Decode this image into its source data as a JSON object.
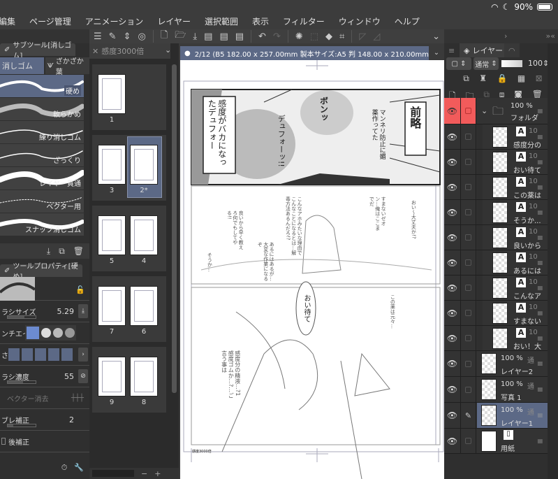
{
  "status": {
    "battery": "90%",
    "battery_level": 0.9
  },
  "menu": [
    "編集",
    "ページ管理",
    "アニメーション",
    "レイヤー",
    "選択範囲",
    "表示",
    "フィルター",
    "ウィンドウ",
    "ヘルプ"
  ],
  "toolbar": {
    "icons": [
      "menu-icon",
      "tool-icon",
      "updown-icon",
      "spiral-icon",
      "new-file-icon",
      "open-folder-icon",
      "save-icon",
      "jpg-export-icon",
      "png-export-icon",
      "psd-export-icon",
      "undo-icon",
      "redo-icon",
      "select-clear-icon",
      "select-invert-icon",
      "fill-icon",
      "transform-icon",
      "ruler-off-icon",
      "ruler-icon",
      "chevron-down-icon"
    ]
  },
  "subtool": {
    "title": "サブツール[消しゴム]",
    "groups": [
      "消しゴム",
      "ざかざか葉"
    ],
    "brushes": [
      "硬め",
      "軟らかめ",
      "練り消しゴム",
      "ざっくり",
      "レイヤー貫通",
      "ベクター用",
      "スナップ消しゴム"
    ],
    "selected": 0
  },
  "toolprop": {
    "title": "ツールプロパティ[硬め]",
    "brush_size_label": "ラシサイズ",
    "brush_size": "5.29",
    "aa_label": "ンチエイリ",
    "hardness_label": "さ",
    "density_label": "ラシ濃度",
    "density": "55",
    "vector_label": "ベクター消去",
    "stab_label": "ブレ補正",
    "stab": "2",
    "post_label": "後補正",
    "brush_size_fraction": 0.6,
    "density_fraction": 0.55,
    "stab_fraction": 0.2
  },
  "pages": {
    "tab": "感度3000倍",
    "items": [
      {
        "label": "1"
      },
      {
        "label": "3"
      },
      {
        "label": "2*"
      },
      {
        "label": "5"
      },
      {
        "label": "4"
      },
      {
        "label": "7"
      },
      {
        "label": "6"
      },
      {
        "label": "9"
      },
      {
        "label": "8"
      }
    ],
    "selected": "2*"
  },
  "canvas": {
    "tab": "2/12 (B5 182.00 x 257.00mm 製本サイズ:A5 判 148.00 x 210.00mm 350dpi 3",
    "texts": {
      "zenryaku": "前略",
      "caption": "感度がバカになったデュフォー",
      "shout": "デュフォーッ!!",
      "boom": "ボンッ",
      "note": "マンネリ防止に媚薬作ってた",
      "p2a": "おい～大丈夫か!?",
      "p2b": "すまないゼオン…俺はここまでだ",
      "p2c": "こんなアホみたいな理由でこんなことになるとは…解毒方法あるんだろ!?",
      "p2d": "あるにはあるが…大変な作業になるぞ",
      "p2e": "良いから早く教えろ何でもしてやる!!",
      "p2f": "そうか…",
      "p3a": "この薬は元々…",
      "p3b": "おい待て",
      "p3c": "感度分の精液…?1感度ゴムか…?…ご言う事は",
      "footer": "感度3000倍"
    }
  },
  "layers": {
    "tab": "レイヤー",
    "blend": "通常",
    "opacity": "100",
    "folder": {
      "pct": "100 %",
      "name": "フォルダ"
    },
    "text_layers": [
      "感度分の",
      "おい待て",
      "この薬は",
      "そうか...",
      "良いから",
      "あるには",
      "こんなア",
      "すまない",
      "おい！大"
    ],
    "raster_layers": [
      {
        "pct": "100 %",
        "mode": "通常",
        "name": "レイヤー2"
      },
      {
        "pct": "100 %",
        "mode": "通常",
        "name": "写真 1"
      },
      {
        "pct": "100 %",
        "mode": "通常",
        "name": "レイヤー1",
        "selected": true
      }
    ],
    "paper": "用紙",
    "text_pct": "10"
  },
  "colors": {
    "accent": "#5c6986",
    "highlight": "#f25b5b"
  }
}
